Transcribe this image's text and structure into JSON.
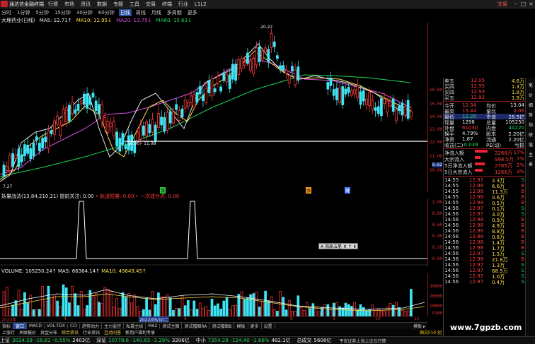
{
  "titlebar": {
    "app_title": "通达信金融终端",
    "menus": [
      "行情",
      "市场",
      "资讯",
      "数据",
      "专题",
      "工具",
      "交易",
      "终端",
      "行业"
    ],
    "right_label": "L1L2",
    "trade_link": "交易",
    "controls": [
      "–",
      "□",
      "×"
    ]
  },
  "periods": {
    "items": [
      {
        "label": "分时",
        "active": false
      },
      {
        "label": "1分钟",
        "active": false
      },
      {
        "label": "5分钟",
        "active": false
      },
      {
        "label": "15分钟",
        "active": false
      },
      {
        "label": "30分钟",
        "active": false
      },
      {
        "label": "60分钟",
        "active": false
      },
      {
        "label": "日线",
        "active": true
      },
      {
        "label": "周线",
        "active": false
      },
      {
        "label": "月线",
        "active": false
      },
      {
        "label": "多周期",
        "active": false
      },
      {
        "label": "更多",
        "active": false
      }
    ]
  },
  "price_header": {
    "name": "大理药业(日线)",
    "ma5": "MA5: 12.71↑",
    "ma10": "MA10: 12.95↓",
    "ma20": "MA20: 13.75↓",
    "ma60": "MA60: 15.63↓"
  },
  "chart": {
    "high_label": "20.22",
    "low_label": "10.90 - 11.08",
    "first_low": "7.27",
    "price_axis": [
      "16.00",
      "15.00",
      "14.00",
      "13.00",
      "12.00",
      "11.00",
      "10.00",
      "8.62"
    ],
    "current_tag": "8.62"
  },
  "indicator": {
    "header": "妖量战法(13,84,210,21)  提前关注: 0.00",
    "legend1": "• 轨道短量: 0.00",
    "legend2": "• 一次建仓点: 0.00",
    "axis": [
      "1.00",
      "0.80",
      "0.60",
      "0.40",
      "0.20",
      "0.00"
    ],
    "signals": [
      {
        "label": "涨",
        "color": "#2ecc40"
      },
      {
        "label": "强",
        "color": "#ff9c1a"
      },
      {
        "label": "财",
        "color": "#4a7dff"
      }
    ],
    "popup": "A 指高五笔 ⬆ ↑ ⬇"
  },
  "volume": {
    "header": "VOLUME: 105250.24↑",
    "ma5": "MA5: 66364.14↑",
    "ma10": "MA10: 49649.45↑",
    "axis": [
      "30000",
      "20000",
      "10000",
      "X100"
    ]
  },
  "dates": {
    "labels": [
      "2022年",
      "4",
      "6",
      "7",
      "8",
      "9",
      "10",
      "11"
    ],
    "cursor": "2022/05/10二"
  },
  "tabs": {
    "items": [
      {
        "label": "指标",
        "active": false
      },
      {
        "label": "窗口",
        "active": true
      },
      {
        "label": "MACD",
        "active": false
      },
      {
        "label": "VOL-TDX",
        "active": false
      },
      {
        "label": "CCI",
        "active": false
      },
      {
        "label": "趋势动力",
        "active": false
      },
      {
        "label": "主力监控",
        "active": false
      },
      {
        "label": "私募主线",
        "active": false
      },
      {
        "label": "MA2",
        "active": false
      },
      {
        "label": "测试主图",
        "active": false
      },
      {
        "label": "测试幅图RA",
        "active": false
      },
      {
        "label": "测试幅图B",
        "active": false
      },
      {
        "label": "模板",
        "active": false
      },
      {
        "label": "更多",
        "active": false
      },
      {
        "label": "设置",
        "active": false
      }
    ],
    "right": "模板 ▸"
  },
  "links": {
    "items": [
      {
        "label": "上涨行",
        "hot": false
      },
      {
        "label": "关联报价",
        "hot": false
      },
      {
        "label": "资金分布",
        "hot": false
      },
      {
        "label": "综合资讯",
        "hot": true
      },
      {
        "label": "行业资讯",
        "hot": false
      },
      {
        "label": "互动问答",
        "hot": true
      },
      {
        "label": "新用户福利专享",
        "hot": false
      }
    ],
    "right_note": "图文F10 创"
  },
  "status_bar": {
    "indices": [
      {
        "name": "上证",
        "value": "3024.39",
        "change": "-16.81",
        "pct": "-0.55%",
        "amount": "2403亿"
      },
      {
        "name": "深证",
        "value": "10778.6",
        "change": "-140.83",
        "pct": "-1.29%",
        "amount": "3206亿"
      },
      {
        "name": "中小",
        "value": "7354.28",
        "change": "-124.40",
        "pct": "-1.66%",
        "amount": "482.1亿"
      }
    ],
    "total_label": "总成交",
    "total_value": "5608亿",
    "note": "平安证券上海上证云行情"
  },
  "side_panel": {
    "asks": [
      {
        "label": "卖五",
        "price": "13.05",
        "vol": "4.6万"
      },
      {
        "label": "买四",
        "price": "12.95",
        "vol": "1.3万"
      },
      {
        "label": "买四",
        "price": "12.93",
        "vol": "1.8万"
      },
      {
        "label": "买五",
        "price": "12.92",
        "vol": "1.9万"
      }
    ],
    "stats": [
      {
        "l1": "今开",
        "v1": "12.34",
        "l2": "均价",
        "v2": "13.04"
      },
      {
        "l1": "最高",
        "v1": "13.44",
        "l2": "量比",
        "v2": "2.06"
      },
      {
        "l1": "最低",
        "v1": "12.28",
        "l2": "市值",
        "v2": "28.5亿"
      },
      {
        "l1": "现量",
        "v1": "1298",
        "l2": "总量",
        "v2": "105250"
      },
      {
        "l1": "外盘",
        "v1": "61030",
        "l2": "内盘",
        "v2": "44220"
      },
      {
        "l1": "换手",
        "v1": "4.79%",
        "l2": "股本",
        "v2": "2.20亿"
      },
      {
        "l1": "净资",
        "v1": "1.87",
        "l2": "流通",
        "v2": "2.20亿"
      },
      {
        "l1": "收益(二)",
        "v1": "-0.039",
        "l2": "PE(动)",
        "v2": "亏损"
      }
    ],
    "flows": [
      {
        "label": "净流入额",
        "value": "2268万",
        "pct": "17%",
        "bar": 0.6
      },
      {
        "label": "大宗流入",
        "value": "998.5万",
        "pct": "7%",
        "bar": 0.25
      },
      {
        "label": "5日净流入额",
        "value": "2765万",
        "pct": "2%",
        "bar": 0.45
      },
      {
        "label": "5日大宗流入",
        "value": "1266万",
        "pct": "3%",
        "bar": 0.35
      }
    ],
    "ticks": [
      {
        "time": "14:55",
        "price": "12.97",
        "vol": "2.3万",
        "dir": "S"
      },
      {
        "time": "14:55",
        "price": "12.98",
        "vol": "6.6万",
        "dir": "B"
      },
      {
        "time": "14:55",
        "price": "12.98",
        "vol": "11.3万",
        "dir": "B"
      },
      {
        "time": "14:55",
        "price": "12.98",
        "vol": "0.6万",
        "dir": "B"
      },
      {
        "time": "14:55",
        "price": "12.98",
        "vol": "0.5万",
        "dir": "B"
      },
      {
        "time": "14:56",
        "price": "12.97",
        "vol": "0.1万",
        "dir": "S"
      },
      {
        "time": "14:56",
        "price": "12.97",
        "vol": "3.0万",
        "dir": "S"
      },
      {
        "time": "14:56",
        "price": "12.98",
        "vol": "0.9万",
        "dir": "B"
      },
      {
        "time": "14:56",
        "price": "12.98",
        "vol": "4.9万",
        "dir": "B"
      },
      {
        "time": "14:56",
        "price": "12.98",
        "vol": "8.8万",
        "dir": "B"
      },
      {
        "time": "14:56",
        "price": "12.98",
        "vol": "0.8万",
        "dir": "B"
      },
      {
        "time": "14:56",
        "price": "12.98",
        "vol": "1.4万",
        "dir": "B"
      },
      {
        "time": "14:56",
        "price": "12.98",
        "vol": "1.7万",
        "dir": "B"
      },
      {
        "time": "14:56",
        "price": "12.97",
        "vol": "1.3万",
        "dir": "S"
      },
      {
        "time": "14:56",
        "price": "12.98",
        "vol": "21.8万",
        "dir": "B"
      },
      {
        "time": "14:56",
        "price": "12.97",
        "vol": "1.3万",
        "dir": "S"
      },
      {
        "time": "14:56",
        "price": "12.97",
        "vol": "68.5万",
        "dir": "S"
      },
      {
        "time": "14:56",
        "price": "12.97",
        "vol": "1.0万",
        "dir": "S"
      },
      {
        "time": "14:56",
        "price": "12.97",
        "vol": "0.4万",
        "dir": "S"
      }
    ],
    "vtabs": [
      "笔",
      "价",
      "细",
      "势",
      "指",
      "联",
      "值",
      "主",
      "筹"
    ]
  },
  "watermark": "www.7gpzb.com"
}
